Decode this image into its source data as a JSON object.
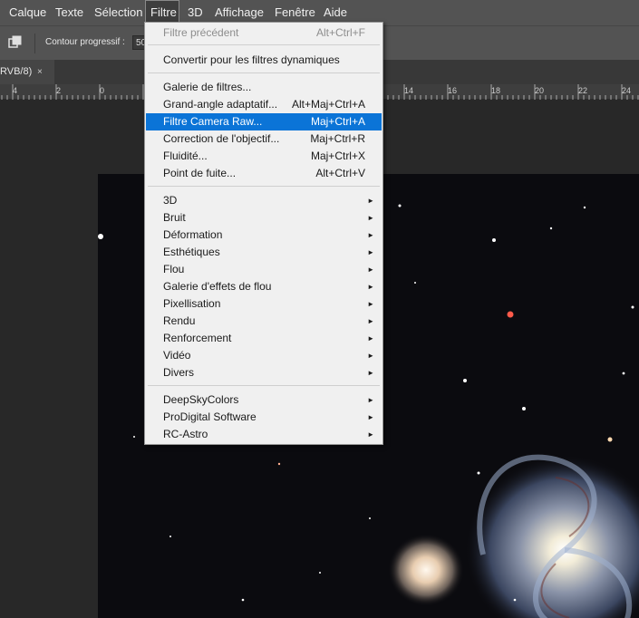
{
  "menubar": {
    "items": [
      "Calque",
      "Texte",
      "Sélection",
      "Filtre",
      "3D",
      "Affichage",
      "Fenêtre",
      "Aide"
    ],
    "active": "Filtre"
  },
  "options": {
    "feather_label": "Contour progressif :",
    "feather_value": "50"
  },
  "tab": {
    "label": "RVB/8)",
    "close": "×"
  },
  "ruler": {
    "labels": [
      "4",
      "2",
      "0",
      "14",
      "16",
      "18",
      "20",
      "22",
      "24"
    ]
  },
  "menu": {
    "last_filter": "Filtre précédent",
    "last_filter_shortcut": "Alt+Ctrl+F",
    "convert_smart": "Convertir pour les filtres dynamiques",
    "filter_gallery": "Galerie de filtres...",
    "adaptive_wide": "Grand-angle adaptatif...",
    "adaptive_wide_shortcut": "Alt+Maj+Ctrl+A",
    "camera_raw": "Filtre Camera Raw...",
    "camera_raw_shortcut": "Maj+Ctrl+A",
    "lens_correction": "Correction de l'objectif...",
    "lens_correction_shortcut": "Maj+Ctrl+R",
    "liquify": "Fluidité...",
    "liquify_shortcut": "Maj+Ctrl+X",
    "vanishing_point": "Point de fuite...",
    "vanishing_point_shortcut": "Alt+Ctrl+V",
    "submenus": [
      "3D",
      "Bruit",
      "Déformation",
      "Esthétiques",
      "Flou",
      "Galerie d'effets de flou",
      "Pixellisation",
      "Rendu",
      "Renforcement",
      "Vidéo",
      "Divers"
    ],
    "plugins": [
      "DeepSkyColors",
      "ProDigital Software",
      "RC-Astro"
    ],
    "arrow": "►"
  }
}
